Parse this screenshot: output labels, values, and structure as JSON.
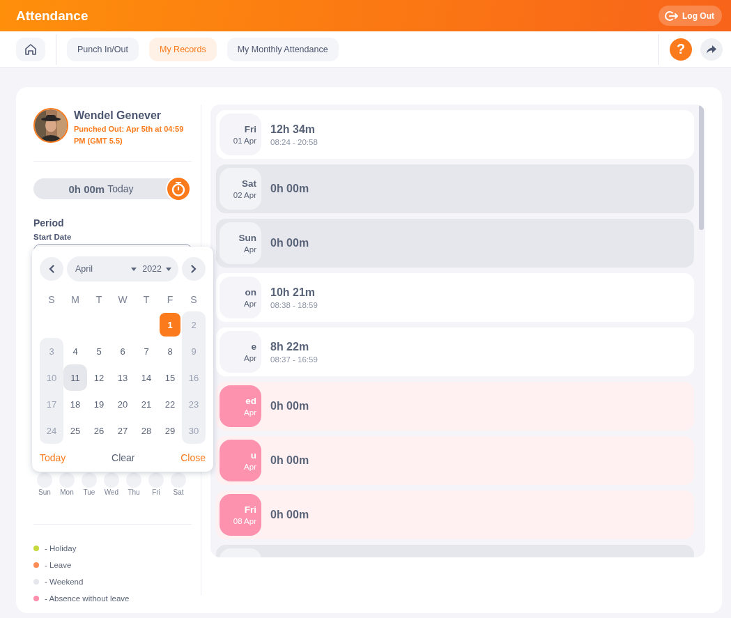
{
  "app_title": "Attendance",
  "logout": "Log Out",
  "nav": {
    "tabs": [
      {
        "label": "Punch In/Out",
        "selected": false
      },
      {
        "label": "My Records",
        "selected": true
      },
      {
        "label": "My Monthly Attendance",
        "selected": false
      }
    ],
    "help": "?"
  },
  "profile": {
    "name": "Wendel Genever",
    "status": "Punched Out: Apr 5th at 04:59 PM (GMT 5.5)"
  },
  "timer": {
    "duration": "0h 00m",
    "label": "Today"
  },
  "period": {
    "title": "Period",
    "start_label": "Start Date"
  },
  "datepicker": {
    "month": "April",
    "year": "2022",
    "weekdays": [
      "S",
      "M",
      "T",
      "W",
      "T",
      "F",
      "S"
    ],
    "cells": [
      {
        "kind": "blank"
      },
      {
        "kind": "blank"
      },
      {
        "kind": "blank"
      },
      {
        "kind": "blank"
      },
      {
        "kind": "blank"
      },
      {
        "kind": "day",
        "d": "1",
        "selected": true,
        "today": false
      },
      {
        "kind": "day",
        "d": "2",
        "selected": false,
        "today": false
      },
      {
        "kind": "day",
        "d": "3",
        "selected": false,
        "today": false
      },
      {
        "kind": "day",
        "d": "4",
        "selected": false,
        "today": false
      },
      {
        "kind": "day",
        "d": "5",
        "selected": false,
        "today": false
      },
      {
        "kind": "day",
        "d": "6",
        "selected": false,
        "today": false
      },
      {
        "kind": "day",
        "d": "7",
        "selected": false,
        "today": false
      },
      {
        "kind": "day",
        "d": "8",
        "selected": false,
        "today": false
      },
      {
        "kind": "day",
        "d": "9",
        "selected": false,
        "today": false
      },
      {
        "kind": "day",
        "d": "10",
        "selected": false,
        "today": false
      },
      {
        "kind": "day",
        "d": "11",
        "selected": false,
        "today": true
      },
      {
        "kind": "day",
        "d": "12",
        "selected": false,
        "today": false
      },
      {
        "kind": "day",
        "d": "13",
        "selected": false,
        "today": false
      },
      {
        "kind": "day",
        "d": "14",
        "selected": false,
        "today": false
      },
      {
        "kind": "day",
        "d": "15",
        "selected": false,
        "today": false
      },
      {
        "kind": "day",
        "d": "16",
        "selected": false,
        "today": false
      },
      {
        "kind": "day",
        "d": "17",
        "selected": false,
        "today": false
      },
      {
        "kind": "day",
        "d": "18",
        "selected": false,
        "today": false
      },
      {
        "kind": "day",
        "d": "19",
        "selected": false,
        "today": false
      },
      {
        "kind": "day",
        "d": "20",
        "selected": false,
        "today": false
      },
      {
        "kind": "day",
        "d": "21",
        "selected": false,
        "today": false
      },
      {
        "kind": "day",
        "d": "22",
        "selected": false,
        "today": false
      },
      {
        "kind": "day",
        "d": "23",
        "selected": false,
        "today": false
      },
      {
        "kind": "day",
        "d": "24",
        "selected": false,
        "today": false
      },
      {
        "kind": "day",
        "d": "25",
        "selected": false,
        "today": false
      },
      {
        "kind": "day",
        "d": "26",
        "selected": false,
        "today": false
      },
      {
        "kind": "day",
        "d": "27",
        "selected": false,
        "today": false
      },
      {
        "kind": "day",
        "d": "28",
        "selected": false,
        "today": false
      },
      {
        "kind": "day",
        "d": "29",
        "selected": false,
        "today": false
      },
      {
        "kind": "day",
        "d": "30",
        "selected": false,
        "today": false
      }
    ],
    "footer": {
      "today": "Today",
      "clear": "Clear",
      "close": "Close"
    }
  },
  "weekday_filter": [
    "Sun",
    "Mon",
    "Tue",
    "Wed",
    "Thu",
    "Fri",
    "Sat"
  ],
  "legend": [
    {
      "label": "- Holiday",
      "color": "#c5d93a"
    },
    {
      "label": "- Leave",
      "color": "#fb8c55"
    },
    {
      "label": "- Weekend",
      "color": "#e6e7ec"
    },
    {
      "label": "- Absence without leave",
      "color": "#fc8fac"
    }
  ],
  "records": [
    {
      "kind": "worked",
      "day": "Fri",
      "date": "01 Apr",
      "hours": "12h 34m",
      "times": "08:24 - 20:58"
    },
    {
      "kind": "weekend",
      "day": "Sat",
      "date": "02 Apr",
      "hours": "0h 00m"
    },
    {
      "kind": "weekend",
      "day": "Sun",
      "date": "Apr",
      "hours": "0h 00m"
    },
    {
      "kind": "worked",
      "day": "on",
      "date": "Apr",
      "hours": "10h 21m",
      "times": "08:38 - 18:59"
    },
    {
      "kind": "worked",
      "day": "e",
      "date": "Apr",
      "hours": "8h 22m",
      "times": "08:37 - 16:59"
    },
    {
      "kind": "absent",
      "day": "ed",
      "date": "Apr",
      "hours": "0h 00m"
    },
    {
      "kind": "absent",
      "day": "u",
      "date": "Apr",
      "hours": "0h 00m"
    },
    {
      "kind": "absent",
      "day": "Fri",
      "date": "08 Apr",
      "hours": "0h 00m"
    },
    {
      "kind": "weekend"
    }
  ]
}
